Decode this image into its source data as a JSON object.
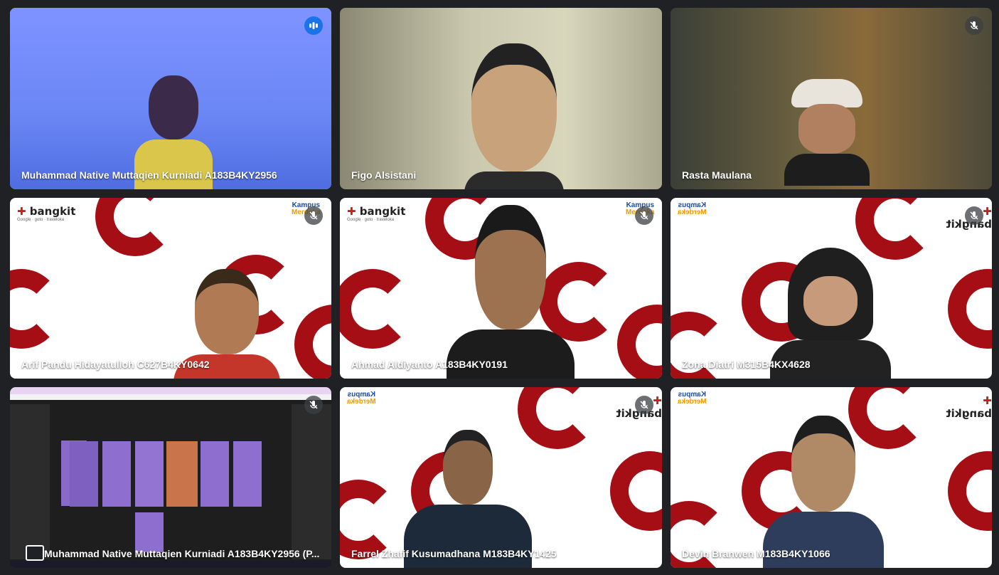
{
  "participants": [
    {
      "name": "Muhammad Native Muttaqien Kurniadi A183B4KY2956",
      "status": "speaking"
    },
    {
      "name": "Figo Alsistani",
      "status": ""
    },
    {
      "name": "Rasta Maulana",
      "status": "muted"
    },
    {
      "name": "Arif Pandu Hidayatulloh C627B4KY0642",
      "status": "muted"
    },
    {
      "name": "Ahmad Aldiyanto A183B4KY0191",
      "status": "muted"
    },
    {
      "name": "Zona Diatri M315B4KX4628",
      "status": "muted"
    },
    {
      "name": "Muhammad Native Muttaqien Kurniadi A183B4KY2956 (P...",
      "status": "presenting"
    },
    {
      "name": "Farrel Zhafif Kusumadhana M183B4KY1425",
      "status": "muted"
    },
    {
      "name": "Devin Branwen M183B4KY1066",
      "status": ""
    }
  ],
  "branding": {
    "bangkit": "bangkit",
    "partners": "Google · goto · traveloka",
    "kampus_line1": "Kampus",
    "kampus_line2": "Merdeka"
  },
  "colors": {
    "background": "#202124",
    "speaking_border": "#8ab4f8",
    "brand_red": "#a50e15"
  },
  "icons": {
    "muted": "mic-off-icon",
    "speaking": "audio-level-icon",
    "presenting": "present-screen-icon"
  }
}
